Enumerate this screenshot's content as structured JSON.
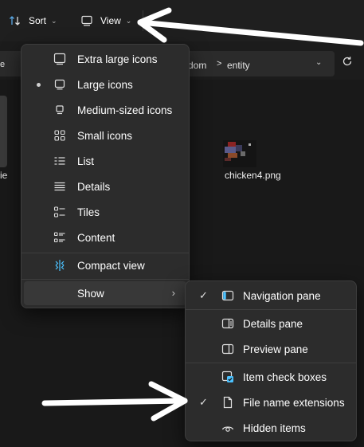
{
  "toolbar": {
    "sort_label": "Sort",
    "view_label": "View",
    "more_label": "…"
  },
  "address": {
    "partial_left": "e",
    "crumb_partial": "dom",
    "crumb_current": "entity",
    "separator": ">"
  },
  "content": {
    "left_partial_label": "ie",
    "file_name": "chicken4.png"
  },
  "view_menu": {
    "items": [
      {
        "label": "Extra large icons",
        "icon": "extra-large-icons-icon",
        "selected": false
      },
      {
        "label": "Large icons",
        "icon": "large-icons-icon",
        "selected": true
      },
      {
        "label": "Medium-sized icons",
        "icon": "medium-icons-icon",
        "selected": false
      },
      {
        "label": "Small icons",
        "icon": "small-icons-icon",
        "selected": false
      },
      {
        "label": "List",
        "icon": "list-icon",
        "selected": false
      },
      {
        "label": "Details",
        "icon": "details-icon",
        "selected": false
      },
      {
        "label": "Tiles",
        "icon": "tiles-icon",
        "selected": false
      },
      {
        "label": "Content",
        "icon": "content-icon",
        "selected": false
      }
    ],
    "compact_view_label": "Compact view",
    "show_label": "Show"
  },
  "show_menu": {
    "items": [
      {
        "label": "Navigation pane",
        "icon": "navigation-pane-icon",
        "checked": true
      },
      {
        "label": "Details pane",
        "icon": "details-pane-icon",
        "checked": false
      },
      {
        "label": "Preview pane",
        "icon": "preview-pane-icon",
        "checked": false
      },
      {
        "label": "Item check boxes",
        "icon": "item-checkboxes-icon",
        "checked": false
      },
      {
        "label": "File name extensions",
        "icon": "file-icon",
        "checked": true
      },
      {
        "label": "Hidden items",
        "icon": "eye-icon",
        "checked": false
      }
    ]
  },
  "colors": {
    "accent": "#4cc2ff",
    "menu_bg": "#2c2c2c",
    "window_bg": "#1c1c1c"
  }
}
